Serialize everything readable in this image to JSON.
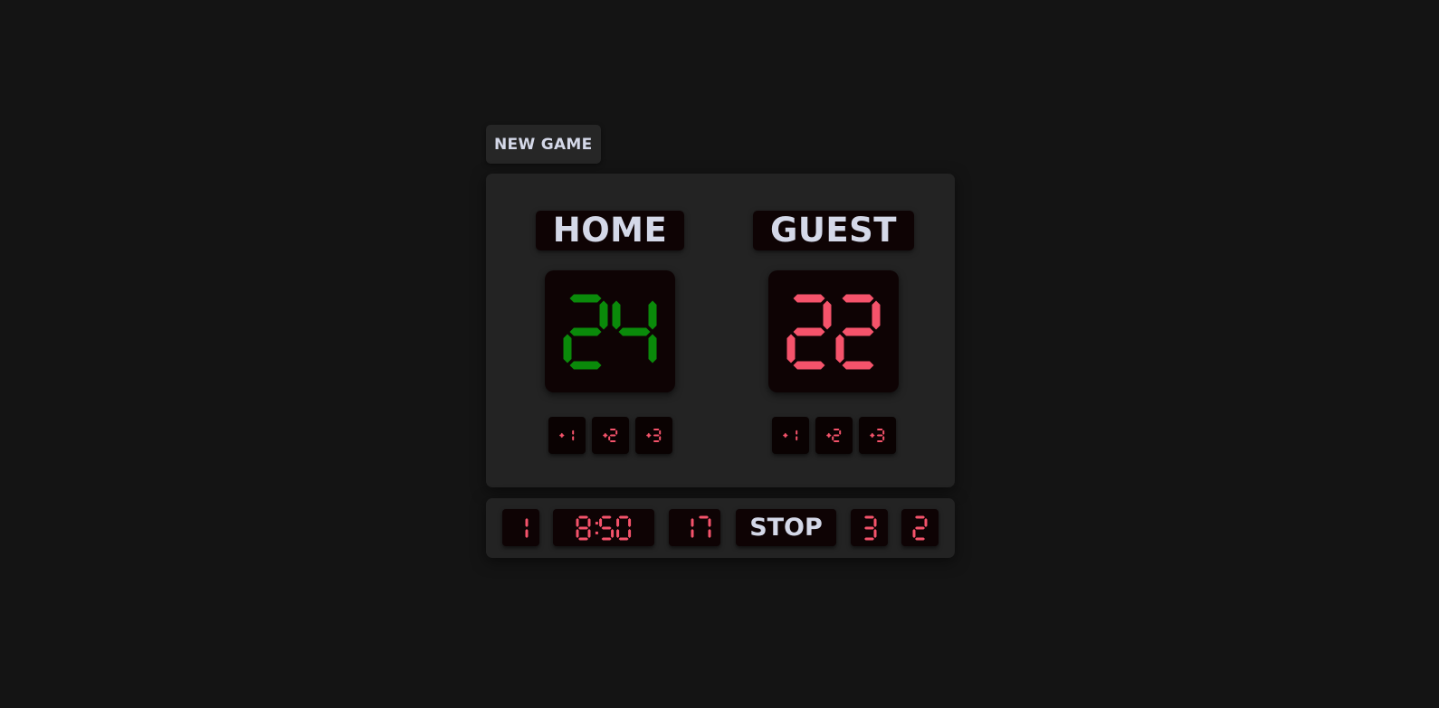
{
  "new_game_label": "NEW GAME",
  "home": {
    "name": "HOME",
    "score": "24",
    "color": "#0a8a0a"
  },
  "guest": {
    "name": "GUEST",
    "score": "22",
    "color": "#f5536b"
  },
  "point_buttons": [
    "+1",
    "+2",
    "+3"
  ],
  "bottom_bar": {
    "period": "1",
    "clock": "8:50",
    "shot_clock": "17",
    "stop_label": "STOP",
    "home_fouls": "3",
    "guest_fouls": "2"
  },
  "digit_color": "#f5536b"
}
